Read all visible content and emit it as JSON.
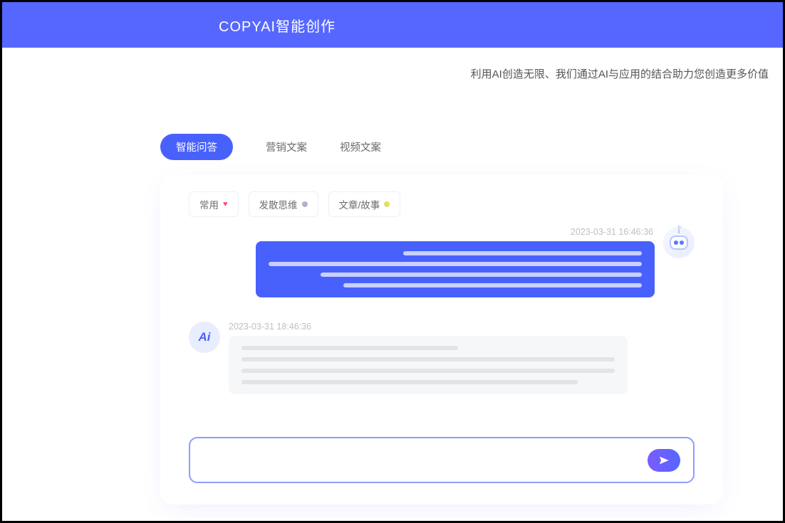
{
  "header": {
    "brand": "COPYAI智能创作"
  },
  "tagline": "利用AI创造无限、我们通过AI与应用的结合助力您创造更多价值",
  "tabs": [
    {
      "label": "智能问答",
      "active": true
    },
    {
      "label": "营销文案",
      "active": false
    },
    {
      "label": "视频文案",
      "active": false
    }
  ],
  "filters": [
    {
      "label": "常用",
      "icon": "heart"
    },
    {
      "label": "发散思维",
      "dot": "#b9b0c7"
    },
    {
      "label": "文章/故事",
      "dot": "#e7dc6b"
    }
  ],
  "messages": [
    {
      "side": "right",
      "avatar": "bot",
      "timestamp": "2023-03-31 16:46:36"
    },
    {
      "side": "left",
      "avatar": "ai",
      "avatar_text": "Ai",
      "timestamp": "2023-03-31 18:46:36"
    }
  ],
  "input": {
    "placeholder": ""
  },
  "icons": {
    "send": "send-icon"
  },
  "colors": {
    "primary": "#5667ff",
    "accent": "#4861fd"
  }
}
